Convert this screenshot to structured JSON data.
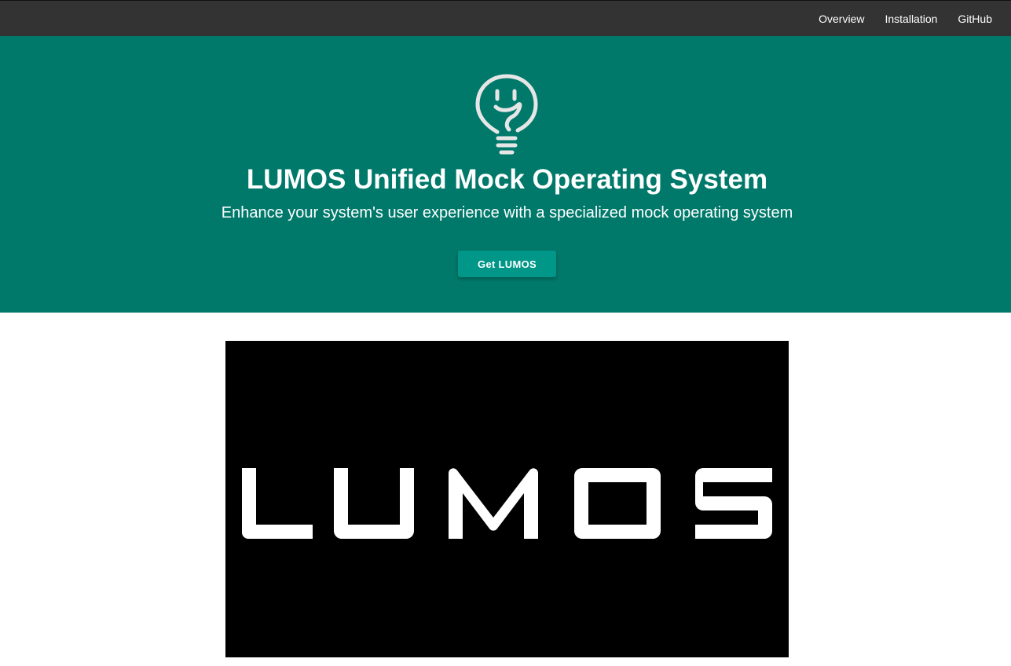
{
  "navbar": {
    "links": [
      {
        "label": "Overview"
      },
      {
        "label": "Installation"
      },
      {
        "label": "GitHub"
      }
    ]
  },
  "hero": {
    "icon": "lightbulb-smiley-icon",
    "title": "LUMOS Unified Mock Operating System",
    "subtitle": "Enhance your system's user experience with a specialized mock operating system",
    "cta_label": "Get LUMOS"
  },
  "banner": {
    "logo_text": "LUMOS"
  },
  "colors": {
    "navbar_bg": "#333333",
    "hero_bg": "#00796b",
    "button_bg": "#009688",
    "banner_bg": "#000000",
    "text_light": "#ffffff"
  }
}
